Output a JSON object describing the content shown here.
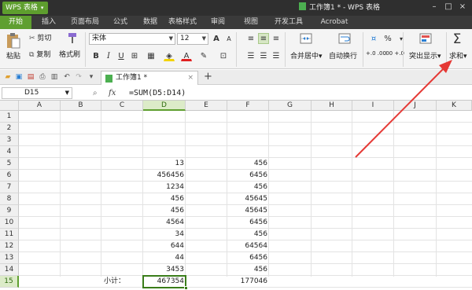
{
  "app": {
    "menu_label": "WPS 表格",
    "doc_title": "工作簿1 * - WPS 表格"
  },
  "menu_tabs": [
    "开始",
    "插入",
    "页面布局",
    "公式",
    "数据",
    "表格样式",
    "审阅",
    "视图",
    "开发工具",
    "Acrobat"
  ],
  "ribbon": {
    "paste": "粘贴",
    "cut": "剪切",
    "copy": "复制",
    "format_painter": "格式刷",
    "font_name": "宋体",
    "font_size": "12",
    "bold": "B",
    "italic": "I",
    "underline": "U",
    "merge_center": "合并居中",
    "wrap_text": "自动换行",
    "percent": "%",
    "decimal_inc": "+.0 .00",
    "decimal_dec": ".00 +.0",
    "conditional": "突出显示",
    "sum_symbol": "Σ",
    "sum_label": "求和"
  },
  "sheet_tab": {
    "label": "工作簿1 *",
    "close": "×",
    "add": "+"
  },
  "formula_bar": {
    "cell_ref": "D15",
    "fx": "fx",
    "formula": "=SUM(D5:D14)"
  },
  "grid": {
    "columns": [
      "A",
      "B",
      "C",
      "D",
      "E",
      "F",
      "G",
      "H",
      "I",
      "J",
      "K"
    ],
    "rows": [
      "1",
      "2",
      "3",
      "4",
      "5",
      "6",
      "7",
      "8",
      "9",
      "10",
      "11",
      "12",
      "13",
      "14",
      "15"
    ],
    "col_d": [
      "",
      "",
      "",
      "",
      "13",
      "456456",
      "1234",
      "456",
      "456",
      "4564",
      "34",
      "644",
      "44",
      "3453",
      "467354"
    ],
    "col_f": [
      "",
      "",
      "",
      "",
      "456",
      "6456",
      "456",
      "45645",
      "45645",
      "6456",
      "456",
      "64564",
      "6456",
      "456",
      "177046"
    ],
    "subtotal_label": "小计：",
    "selected_cell": "D15"
  },
  "colors": {
    "accent": "#5f9f30",
    "arrow": "#e53935"
  }
}
